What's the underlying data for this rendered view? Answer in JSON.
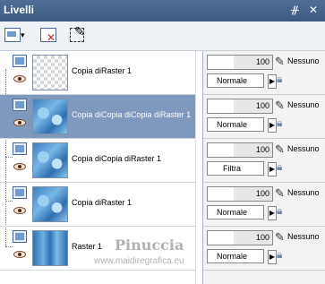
{
  "window": {
    "title": "Livelli"
  },
  "titlebar_icons": [
    "pin-icon",
    "close-icon"
  ],
  "toolbar": {
    "tools": [
      "new-layer-icon",
      "dropdown-icon",
      "delete-layer-icon",
      "edit-selection-icon"
    ]
  },
  "layers": [
    {
      "name": "Copia diRaster 1",
      "opacity": "100",
      "blend": "Normale",
      "selected": false,
      "thumb": "transparent"
    },
    {
      "name": "Copia diCopia diCopia diRaster 1",
      "opacity": "100",
      "blend": "Normale",
      "selected": true,
      "thumb": "texture"
    },
    {
      "name": "Copia diCopia diRaster 1",
      "opacity": "100",
      "blend": "Filtra",
      "selected": false,
      "thumb": "texture"
    },
    {
      "name": "Copia diRaster 1",
      "opacity": "100",
      "blend": "Normale",
      "selected": false,
      "thumb": "texture"
    },
    {
      "name": "Raster 1",
      "opacity": "100",
      "blend": "Normale",
      "selected": false,
      "thumb": "solid"
    }
  ],
  "blend_group_label": "Nessuno",
  "watermark": {
    "line1": "Pinuccia",
    "line2": "www.maidiregrafica.eu"
  }
}
